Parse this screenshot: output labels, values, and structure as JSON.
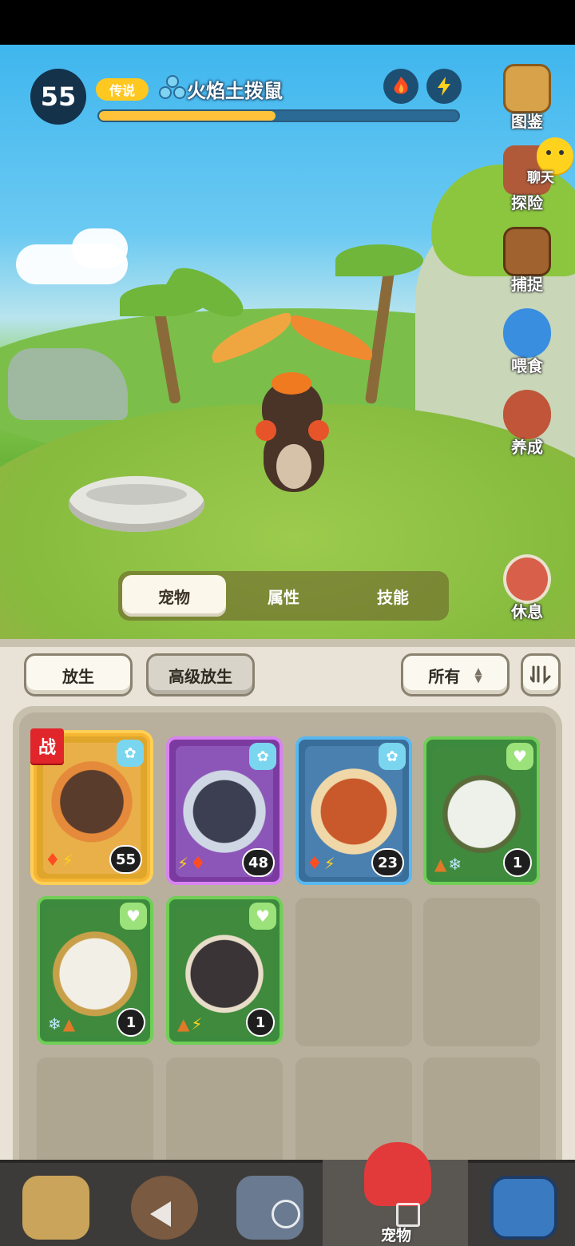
{
  "hud": {
    "level": "55",
    "rarity": "传说",
    "pet_name": "火焰土拨鼠",
    "xp_progress": 0.49,
    "types": [
      "fire-icon",
      "lightning-icon"
    ]
  },
  "side_menu": [
    {
      "id": "codex",
      "label": "图鉴",
      "icon": "map-book-icon"
    },
    {
      "id": "explore",
      "label": "探险",
      "icon": "explore-icon"
    },
    {
      "id": "capture",
      "label": "捕捉",
      "icon": "cage-icon"
    },
    {
      "id": "feed",
      "label": "喂食",
      "icon": "feed-icon"
    },
    {
      "id": "train",
      "label": "养成",
      "icon": "train-icon"
    },
    {
      "id": "rest",
      "label": "休息",
      "icon": "sleep-icon"
    }
  ],
  "chat": {
    "label": "聊天",
    "icon": "chat-face-icon"
  },
  "tabs": [
    {
      "label": "宠物",
      "active": true
    },
    {
      "label": "属性",
      "active": false
    },
    {
      "label": "技能",
      "active": false
    }
  ],
  "toolbar": {
    "release": "放生",
    "advanced_release": "高级放生",
    "filter": "所有",
    "sort_icon": "sort-icon"
  },
  "battle_badge": "战",
  "pets": [
    {
      "level": "55",
      "corner": "element-cyan-icon",
      "types": [
        "fire-icon",
        "lightning-icon"
      ],
      "frame": "selected"
    },
    {
      "level": "48",
      "corner": "element-cyan-icon",
      "types": [
        "lightning-icon",
        "fire-icon"
      ],
      "frame": "purple"
    },
    {
      "level": "23",
      "corner": "element-cyan-icon",
      "types": [
        "fire-icon",
        "lightning-icon"
      ],
      "frame": "blue"
    },
    {
      "level": "1",
      "corner": "heart-plus-icon",
      "types": [
        "ground-icon",
        "ice-icon"
      ],
      "frame": "green"
    },
    {
      "level": "1",
      "corner": "heart-plus-icon",
      "types": [
        "ice-icon",
        "ground-icon"
      ],
      "frame": "green"
    },
    {
      "level": "1",
      "corner": "heart-plus-icon",
      "types": [
        "ground-icon",
        "lightning-icon"
      ],
      "frame": "green"
    }
  ],
  "bottom_nav": {
    "active_label": "宠物",
    "items": [
      "camp-icon",
      "trainer-icon",
      "equipment-icon",
      "pet-icon",
      "shop-icon"
    ]
  },
  "colors": {
    "xp_fill": "#ffc23a",
    "rarity": "#ffc820",
    "battle_flag": "#e0262a",
    "selected_frame": "#f6b532"
  }
}
